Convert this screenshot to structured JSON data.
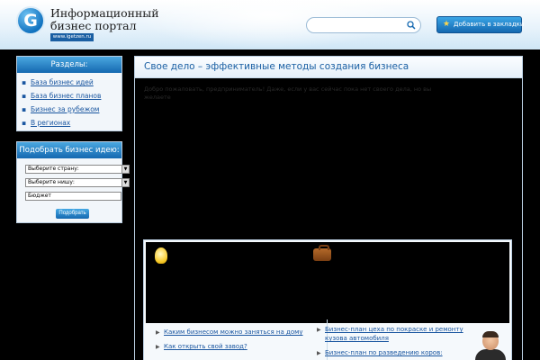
{
  "header": {
    "logo_letter": "G",
    "title_line1": "Информационный",
    "title_line2": "бизнес портал",
    "url": "www.igetzen.ru",
    "search_placeholder": "",
    "bookmark_label": "Добавить в закладки"
  },
  "sidebar": {
    "sections_title": "Разделы:",
    "sections": [
      {
        "label": "База бизнес идей"
      },
      {
        "label": "База бизнес планов"
      },
      {
        "label": "Бизнес за рубежом"
      },
      {
        "label": "В регионах"
      }
    ],
    "finder_title": "Подобрать бизнес идею:",
    "country_select": "Выберите страну:",
    "niche_select": "Выберите нишу:",
    "budget_input": "Бюджет",
    "submit_label": "Подобрать"
  },
  "main": {
    "title": "Свое дело – эффективные методы создания бизнеса",
    "intro": "Добро пожаловать, предприниматель! Даже, если у вас сейчас пока нет своего дела, но вы желаете"
  },
  "topics": {
    "left_links": [
      "Каким бизнесом можно заняться на дому",
      "Как открыть свой завод?"
    ],
    "right_links": [
      "Бизнес-план цеха по покраске и ремонту",
      "кузова автомобиля",
      "Бизнес-план по разведению коров:"
    ]
  }
}
